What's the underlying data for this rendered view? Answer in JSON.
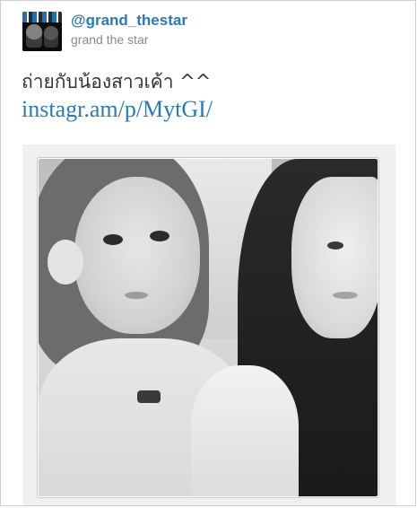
{
  "tweet": {
    "handle": "@grand_thestar",
    "display_name": "grand the star",
    "text": "ถ่ายกับน้องสาวเค้า ^^",
    "link": "instagr.am/p/MytGI/"
  },
  "media": {
    "type": "photo",
    "style": "grayscale selfie of two girls"
  },
  "colors": {
    "link": "#2a7ab8",
    "text": "#333333",
    "secondary": "#8a8a8a",
    "media_background": "#f0f0f0"
  }
}
